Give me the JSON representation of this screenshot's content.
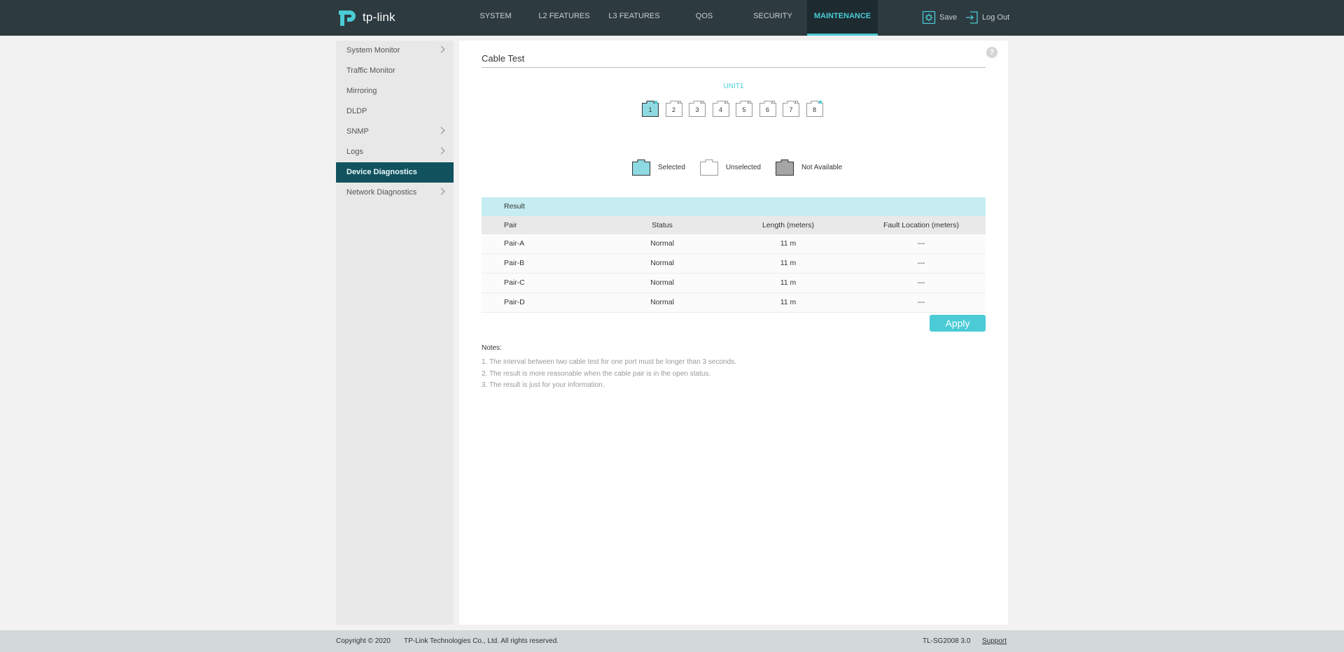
{
  "header": {
    "brand": "tp-link",
    "nav": [
      {
        "label": "SYSTEM",
        "active": false
      },
      {
        "label": "L2 FEATURES",
        "active": false
      },
      {
        "label": "L3 FEATURES",
        "active": false
      },
      {
        "label": "QoS",
        "active": false
      },
      {
        "label": "SECURITY",
        "active": false
      },
      {
        "label": "MAINTENANCE",
        "active": true
      }
    ],
    "save_label": "Save",
    "logout_label": "Log Out"
  },
  "sidebar": {
    "items": [
      {
        "label": "System Monitor",
        "has_submenu": true
      },
      {
        "label": "Traffic Monitor",
        "has_submenu": false
      },
      {
        "label": "Mirroring",
        "has_submenu": false
      },
      {
        "label": "DLDP",
        "has_submenu": false
      },
      {
        "label": "SNMP",
        "has_submenu": true
      },
      {
        "label": "Logs",
        "has_submenu": true
      },
      {
        "label": "Device Diagnostics",
        "has_submenu": false,
        "active": true
      },
      {
        "label": "Network Diagnostics",
        "has_submenu": true
      }
    ]
  },
  "main": {
    "title": "Cable Test",
    "help_label": "?",
    "unit_label": "UNIT1",
    "ports": [
      {
        "number": "1",
        "state": "selected",
        "link": true
      },
      {
        "number": "2",
        "state": "unselected",
        "link": false
      },
      {
        "number": "3",
        "state": "unselected",
        "link": false
      },
      {
        "number": "4",
        "state": "unselected",
        "link": false
      },
      {
        "number": "5",
        "state": "unselected",
        "link": false
      },
      {
        "number": "6",
        "state": "unselected",
        "link": false
      },
      {
        "number": "7",
        "state": "unselected",
        "link": false
      },
      {
        "number": "8",
        "state": "unselected",
        "link": true
      }
    ],
    "legend": {
      "selected": "Selected",
      "unselected": "Unselected",
      "not_available": "Not Available"
    },
    "result": {
      "title": "Result",
      "columns": {
        "pair": "Pair",
        "status": "Status",
        "length": "Length (meters)",
        "fault": "Fault Location (meters)"
      },
      "rows": [
        {
          "pair": "Pair-A",
          "status": "Normal",
          "length": "11 m",
          "fault": "---"
        },
        {
          "pair": "Pair-B",
          "status": "Normal",
          "length": "11 m",
          "fault": "---"
        },
        {
          "pair": "Pair-C",
          "status": "Normal",
          "length": "11 m",
          "fault": "---"
        },
        {
          "pair": "Pair-D",
          "status": "Normal",
          "length": "11 m",
          "fault": "---"
        }
      ]
    },
    "apply_label": "Apply",
    "notes": {
      "title": "Notes:",
      "items": [
        "1. The interval between two cable test for one port must be longer than 3 seconds.",
        "2. The result is more reasonable when the cable pair is in the open status.",
        "3. The result is just for your information."
      ]
    }
  },
  "footer": {
    "copyright": "Copyright © 2020",
    "company": "TP-Link Technologies Co., Ltd. All rights reserved.",
    "model": "TL-SG2008 3.0",
    "support": "Support"
  },
  "colors": {
    "header_bg": "#2d3a3f",
    "accent": "#4acbd6",
    "sidebar_active": "#12525f",
    "result_head_bg": "#c6edf1"
  }
}
